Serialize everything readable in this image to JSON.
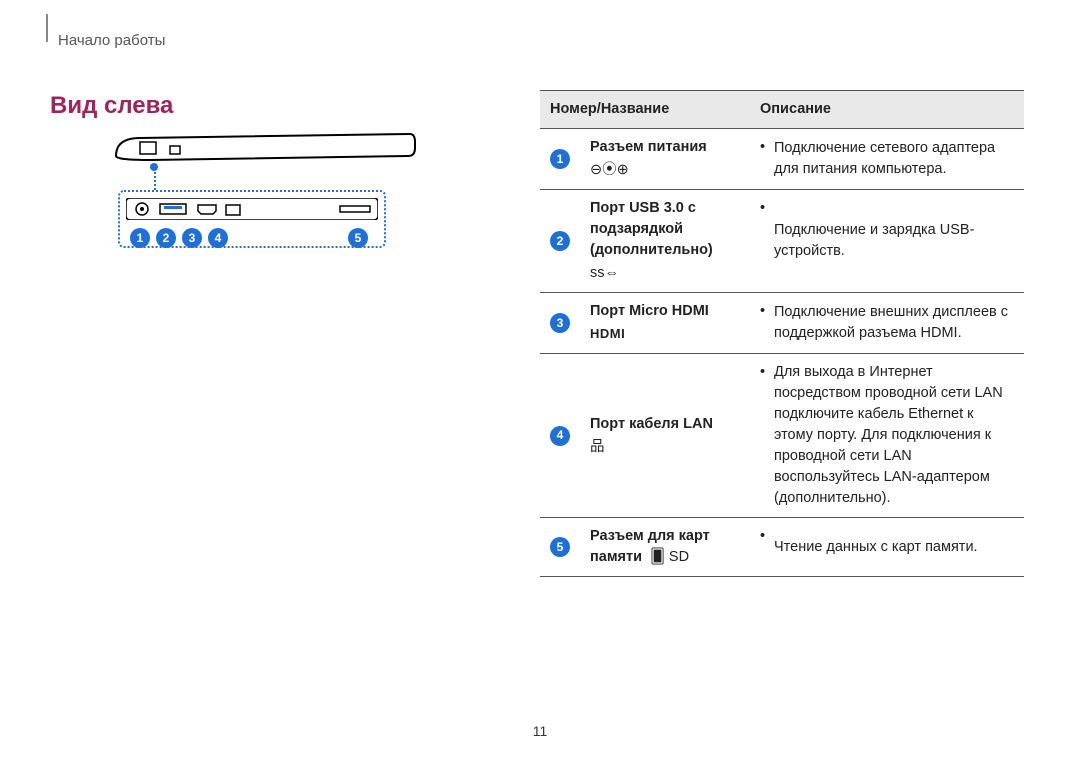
{
  "breadcrumb": "Начало работы",
  "heading": "Вид слева",
  "page_number": "11",
  "callouts": [
    "1",
    "2",
    "3",
    "4",
    "5"
  ],
  "table": {
    "head": {
      "name": "Номер/Название",
      "desc": "Описание"
    },
    "rows": [
      {
        "num": "1",
        "name": "Разъем питания",
        "icon_name": "dc-in-icon",
        "icon_text": "⊖⦿⊕",
        "desc": "Подключение сетевого адаптера для питания компьютера."
      },
      {
        "num": "2",
        "name": "Порт USB 3.0 с подзарядкой (дополнительно)",
        "icon_name": "usb3-charge-icon",
        "icon_text": "ss⇔",
        "desc": "Подключение и зарядка USB-устройств."
      },
      {
        "num": "3",
        "name": "Порт Micro HDMI",
        "icon_name": "hdmi-icon",
        "icon_text": "HDMI",
        "desc": "Подключение внешних дисплеев с поддержкой разъема HDMI."
      },
      {
        "num": "4",
        "name": "Порт кабеля LAN",
        "icon_name": "lan-icon",
        "icon_text": "品",
        "desc": "Для выхода в Интернет посредством проводной сети LAN подключите кабель Ethernet к этому порту. Для подключения к проводной сети LAN воспользуйтесь LAN-адаптером (дополнительно)."
      },
      {
        "num": "5",
        "name": "Разъем для карт памяти",
        "icon_name": "sd-icon",
        "icon_text": "🂠 SD",
        "desc": "Чтение данных с карт памяти."
      }
    ]
  }
}
